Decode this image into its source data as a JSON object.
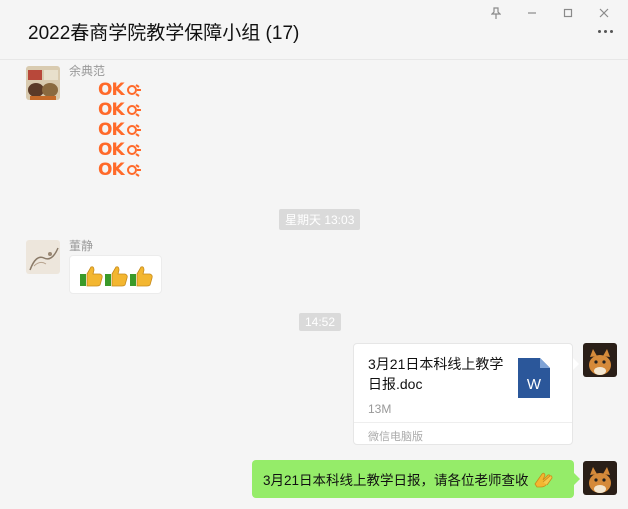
{
  "header": {
    "title": "2022春商学院教学保障小组 (17)"
  },
  "messages": [
    {
      "sender": "余典范",
      "ok_stickers": [
        "OK",
        "OK",
        "OK",
        "OK",
        "OK"
      ]
    },
    {
      "timestamp": "星期天 13:03"
    },
    {
      "sender": "董静",
      "thumbs_count": 3
    },
    {
      "timestamp": "14:52"
    },
    {
      "file": {
        "name": "3月21日本科线上教学日报.doc",
        "size": "13M",
        "source": "微信电脑版",
        "icon": "word-doc-icon"
      }
    },
    {
      "text": "3月21日本科线上教学日报，请各位老师查收",
      "emoji": "clap-hands-icon"
    }
  ],
  "colors": {
    "green_bubble": "#95ec69",
    "ok_orange": "#ff6a2a",
    "word_blue": "#2b579a"
  }
}
